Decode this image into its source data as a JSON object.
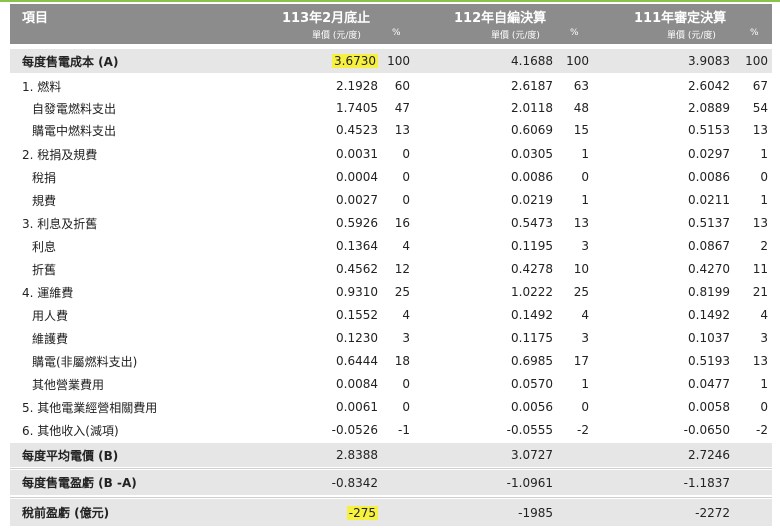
{
  "headers": {
    "item": "項目",
    "col1": "113年2月底止",
    "col2": "112年自編決算",
    "col3": "111年審定決算",
    "unit": "單價 (元/度)",
    "pct": "%"
  },
  "rows": [
    {
      "label": "每度售電成本 (A)",
      "v1": "3.6730",
      "p1": "100",
      "v2": "4.1688",
      "p2": "100",
      "v3": "3.9083",
      "p3": "100"
    },
    {
      "label": "1. 燃料",
      "v1": "2.1928",
      "p1": "60",
      "v2": "2.6187",
      "p2": "63",
      "v3": "2.6042",
      "p3": "67"
    },
    {
      "label": "自發電燃料支出",
      "v1": "1.7405",
      "p1": "47",
      "v2": "2.0118",
      "p2": "48",
      "v3": "2.0889",
      "p3": "54"
    },
    {
      "label": "購電中燃料支出",
      "v1": "0.4523",
      "p1": "13",
      "v2": "0.6069",
      "p2": "15",
      "v3": "0.5153",
      "p3": "13"
    },
    {
      "label": "2. 稅捐及規費",
      "v1": "0.0031",
      "p1": "0",
      "v2": "0.0305",
      "p2": "1",
      "v3": "0.0297",
      "p3": "1"
    },
    {
      "label": "稅捐",
      "v1": "0.0004",
      "p1": "0",
      "v2": "0.0086",
      "p2": "0",
      "v3": "0.0086",
      "p3": "0"
    },
    {
      "label": "規費",
      "v1": "0.0027",
      "p1": "0",
      "v2": "0.0219",
      "p2": "1",
      "v3": "0.0211",
      "p3": "1"
    },
    {
      "label": "3. 利息及折舊",
      "v1": "0.5926",
      "p1": "16",
      "v2": "0.5473",
      "p2": "13",
      "v3": "0.5137",
      "p3": "13"
    },
    {
      "label": "利息",
      "v1": "0.1364",
      "p1": "4",
      "v2": "0.1195",
      "p2": "3",
      "v3": "0.0867",
      "p3": "2"
    },
    {
      "label": "折舊",
      "v1": "0.4562",
      "p1": "12",
      "v2": "0.4278",
      "p2": "10",
      "v3": "0.4270",
      "p3": "11"
    },
    {
      "label": "4. 運維費",
      "v1": "0.9310",
      "p1": "25",
      "v2": "1.0222",
      "p2": "25",
      "v3": "0.8199",
      "p3": "21"
    },
    {
      "label": "用人費",
      "v1": "0.1552",
      "p1": "4",
      "v2": "0.1492",
      "p2": "4",
      "v3": "0.1492",
      "p3": "4"
    },
    {
      "label": "維護費",
      "v1": "0.1230",
      "p1": "3",
      "v2": "0.1175",
      "p2": "3",
      "v3": "0.1037",
      "p3": "3"
    },
    {
      "label": "購電(非屬燃料支出)",
      "v1": "0.6444",
      "p1": "18",
      "v2": "0.6985",
      "p2": "17",
      "v3": "0.5193",
      "p3": "13"
    },
    {
      "label": "其他營業費用",
      "v1": "0.0084",
      "p1": "0",
      "v2": "0.0570",
      "p2": "1",
      "v3": "0.0477",
      "p3": "1"
    },
    {
      "label": "5. 其他電業經營相關費用",
      "v1": "0.0061",
      "p1": "0",
      "v2": "0.0056",
      "p2": "0",
      "v3": "0.0058",
      "p3": "0"
    },
    {
      "label": "6. 其他收入(減項)",
      "v1": "-0.0526",
      "p1": "-1",
      "v2": "-0.0555",
      "p2": "-2",
      "v3": "-0.0650",
      "p3": "-2"
    },
    {
      "label": "每度平均電價 (B)",
      "v1": "2.8388",
      "p1": "",
      "v2": "3.0727",
      "p2": "",
      "v3": "2.7246",
      "p3": ""
    },
    {
      "label": "每度售電盈虧 (B -A)",
      "v1": "-0.8342",
      "p1": "",
      "v2": "-1.0961",
      "p2": "",
      "v3": "-1.1837",
      "p3": ""
    },
    {
      "label": "稅前盈虧 (億元)",
      "v1": "-275",
      "p1": "",
      "v2": "-1985",
      "p2": "",
      "v3": "-2272",
      "p3": ""
    }
  ],
  "colors": {
    "header_bg": "#8c8c8c",
    "highlight": "#f6f040",
    "summary_bg": "#e6e6e6",
    "accent": "#8bc34a"
  }
}
